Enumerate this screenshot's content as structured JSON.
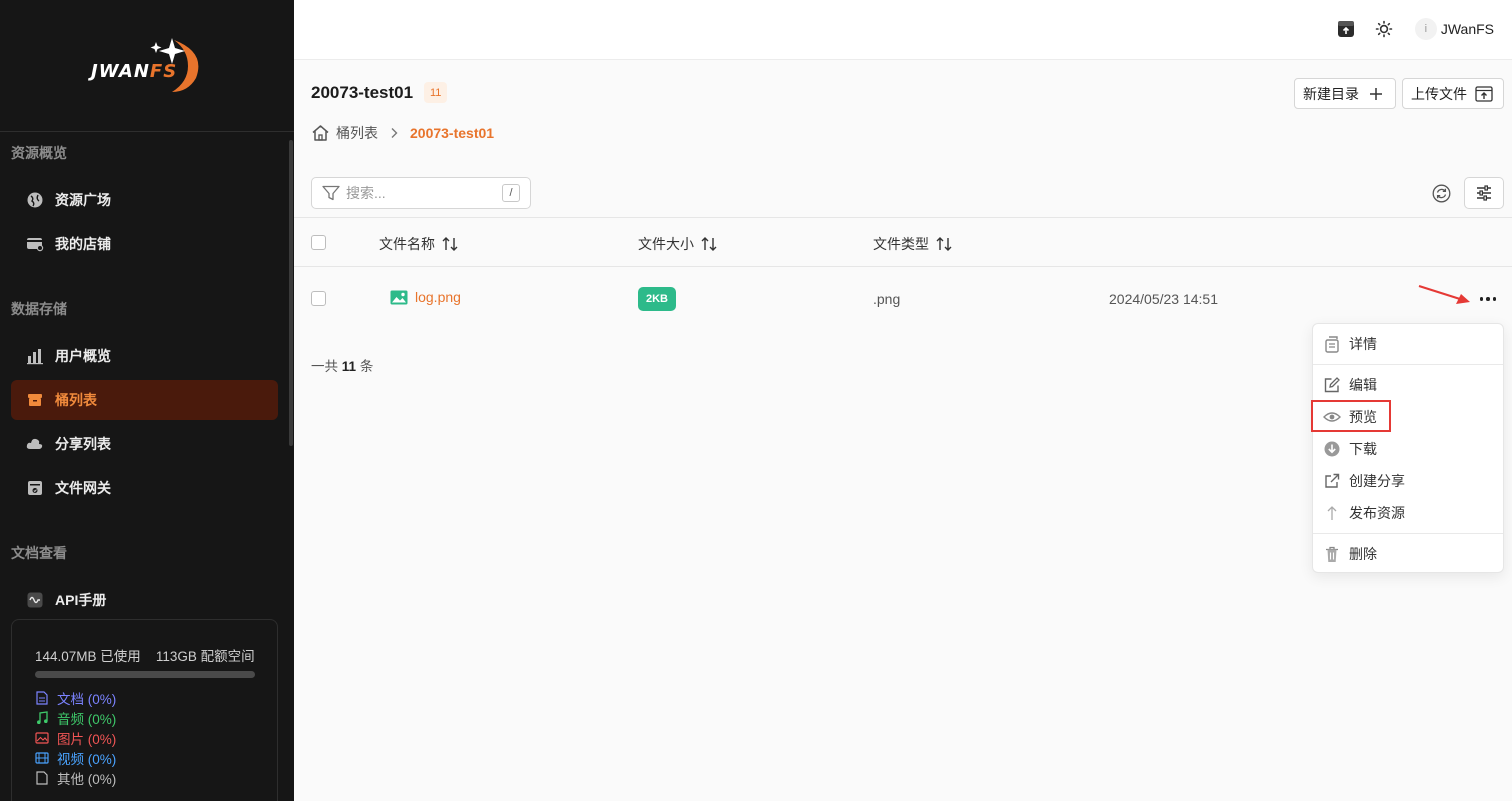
{
  "app": {
    "logo_main": "JWAN",
    "logo_accent": "FS"
  },
  "sidebar": {
    "sections": [
      {
        "title": "资源概览",
        "items": [
          {
            "label": "资源广场",
            "icon": "globe-icon"
          },
          {
            "label": "我的店铺",
            "icon": "shop-icon"
          }
        ]
      },
      {
        "title": "数据存储",
        "items": [
          {
            "label": "用户概览",
            "icon": "bar-chart-icon"
          },
          {
            "label": "桶列表",
            "icon": "bucket-icon",
            "active": true
          },
          {
            "label": "分享列表",
            "icon": "cloud-share-icon"
          },
          {
            "label": "文件网关",
            "icon": "gateway-icon"
          }
        ]
      },
      {
        "title": "文档查看",
        "items": [
          {
            "label": "API手册",
            "icon": "api-icon"
          }
        ]
      }
    ],
    "usage": {
      "used": "144.07MB 已使用",
      "quota": "113GB 配额空间",
      "used_fraction": 0.0,
      "legend": [
        {
          "label": "文档 (0%)",
          "color": "#7b83ff",
          "icon": "document-icon"
        },
        {
          "label": "音频 (0%)",
          "color": "#3ec96a",
          "icon": "music-icon"
        },
        {
          "label": "图片 (0%)",
          "color": "#f25555",
          "icon": "image-icon"
        },
        {
          "label": "视频 (0%)",
          "color": "#4aa3ff",
          "icon": "video-icon"
        },
        {
          "label": "其他 (0%)",
          "color": "#bdbdbd",
          "icon": "file-icon"
        }
      ]
    }
  },
  "topbar": {
    "avatar_initial": "i",
    "username": "JWanFS"
  },
  "main": {
    "title": "20073-test01",
    "count": "11",
    "new_folder_label": "新建目录",
    "upload_label": "上传文件",
    "breadcrumb": {
      "home": "桶列表",
      "current": "20073-test01"
    },
    "search": {
      "placeholder": "搜索...",
      "shortcut": "/"
    },
    "table": {
      "columns": [
        "文件名称",
        "文件大小",
        "文件类型"
      ],
      "rows": [
        {
          "name": "log.png",
          "size": "2KB",
          "type": ".png",
          "date": "2024/05/23 14:51"
        }
      ]
    },
    "total_prefix": "一共",
    "total_count": "11",
    "total_suffix": "条"
  },
  "menu": {
    "items": [
      {
        "label": "详情",
        "icon": "details-icon"
      },
      {
        "label": "编辑",
        "icon": "edit-icon"
      },
      {
        "label": "预览",
        "icon": "eye-icon",
        "highlighted": true
      },
      {
        "label": "下载",
        "icon": "download-icon"
      },
      {
        "label": "创建分享",
        "icon": "external-link-icon"
      },
      {
        "label": "发布资源",
        "icon": "publish-icon"
      },
      {
        "label": "删除",
        "icon": "trash-icon"
      }
    ]
  },
  "colors": {
    "accent": "#e8742c",
    "sidebar_bg": "#161616",
    "active_bg": "#4a1a0c",
    "size_badge": "#2dba8a",
    "highlight": "#e53935"
  }
}
